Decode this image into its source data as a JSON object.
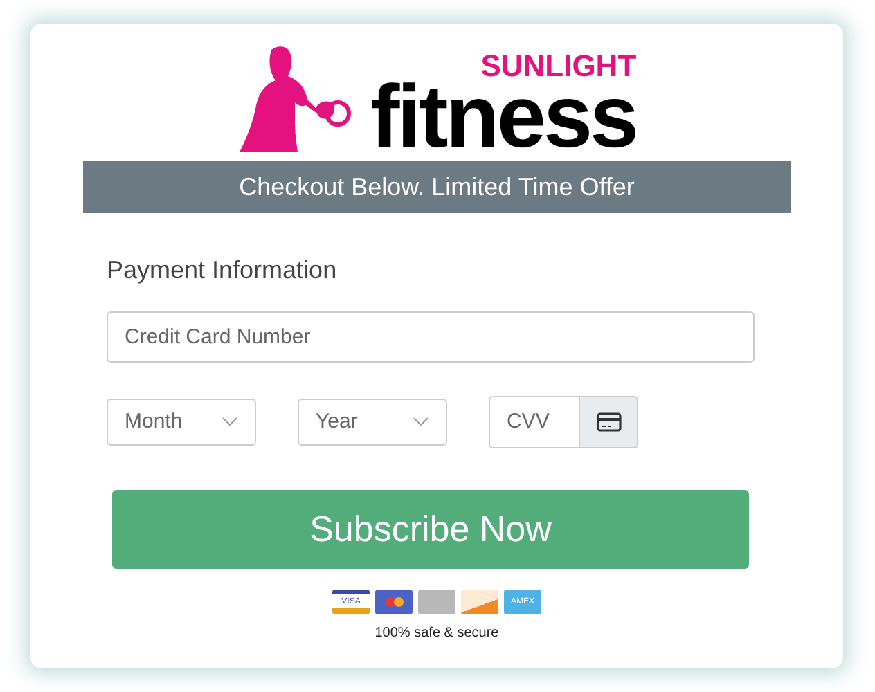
{
  "logo": {
    "brand": "SUNLIGHT",
    "word": "fitness"
  },
  "banner": "Checkout Below. Limited Time Offer",
  "form": {
    "heading": "Payment Information",
    "card_number": {
      "placeholder": "Credit Card Number"
    },
    "month": {
      "placeholder": "Month"
    },
    "year": {
      "placeholder": "Year"
    },
    "cvv": {
      "placeholder": "CVV"
    }
  },
  "submit": "Subscribe Now",
  "payment_cards": [
    {
      "kind": "visa",
      "label": "VISA"
    },
    {
      "kind": "mastercard"
    },
    {
      "kind": "generic"
    },
    {
      "kind": "discover"
    },
    {
      "kind": "amex",
      "label": "AMEX"
    }
  ],
  "secure_note": "100% safe & secure"
}
